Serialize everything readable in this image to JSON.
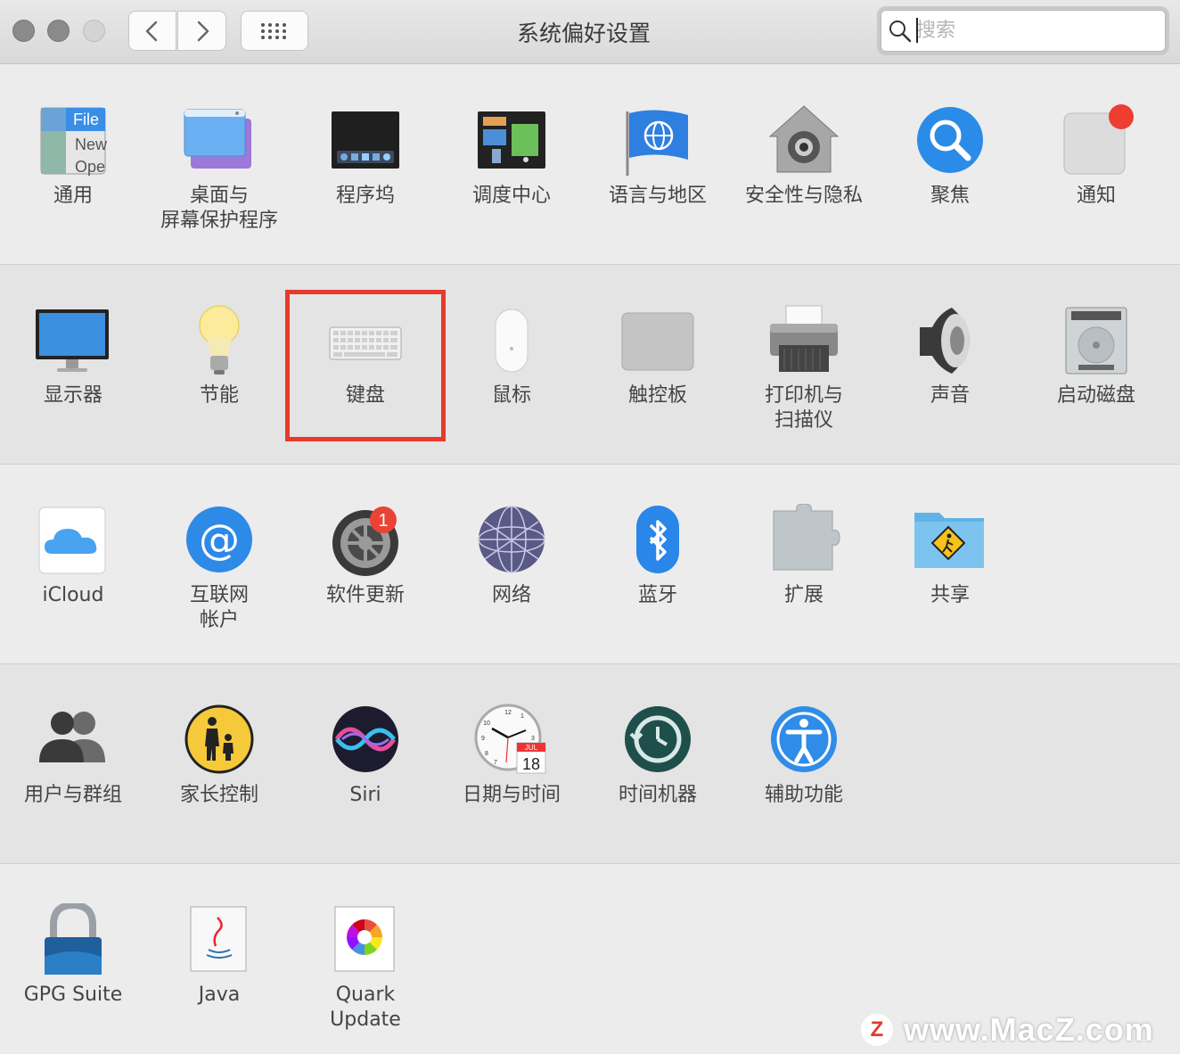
{
  "window": {
    "title": "系统偏好设置"
  },
  "search": {
    "placeholder": "搜索"
  },
  "toolbar": {
    "back_icon": "chevron-left-icon",
    "forward_icon": "chevron-right-icon",
    "grid_icon": "grid-icon"
  },
  "rows": [
    [
      {
        "id": "general",
        "label": [
          "通用"
        ]
      },
      {
        "id": "desktop",
        "label": [
          "桌面与",
          "屏幕保护程序"
        ]
      },
      {
        "id": "dock",
        "label": [
          "程序坞"
        ]
      },
      {
        "id": "mission",
        "label": [
          "调度中心"
        ]
      },
      {
        "id": "language",
        "label": [
          "语言与地区"
        ]
      },
      {
        "id": "security",
        "label": [
          "安全性与隐私"
        ]
      },
      {
        "id": "spotlight",
        "label": [
          "聚焦"
        ]
      },
      {
        "id": "notifications",
        "label": [
          "通知"
        ]
      }
    ],
    [
      {
        "id": "displays",
        "label": [
          "显示器"
        ]
      },
      {
        "id": "energy",
        "label": [
          "节能"
        ]
      },
      {
        "id": "keyboard",
        "label": [
          "键盘"
        ]
      },
      {
        "id": "mouse",
        "label": [
          "鼠标"
        ]
      },
      {
        "id": "trackpad",
        "label": [
          "触控板"
        ]
      },
      {
        "id": "printers",
        "label": [
          "打印机与",
          "扫描仪"
        ]
      },
      {
        "id": "sound",
        "label": [
          "声音"
        ]
      },
      {
        "id": "startup",
        "label": [
          "启动磁盘"
        ]
      }
    ],
    [
      {
        "id": "icloud",
        "label": [
          "iCloud"
        ]
      },
      {
        "id": "internet",
        "label": [
          "互联网",
          "帐户"
        ]
      },
      {
        "id": "update",
        "label": [
          "软件更新"
        ],
        "badge": "1"
      },
      {
        "id": "network",
        "label": [
          "网络"
        ]
      },
      {
        "id": "bluetooth",
        "label": [
          "蓝牙"
        ]
      },
      {
        "id": "extensions",
        "label": [
          "扩展"
        ]
      },
      {
        "id": "sharing",
        "label": [
          "共享"
        ]
      }
    ],
    [
      {
        "id": "users",
        "label": [
          "用户与群组"
        ]
      },
      {
        "id": "parental",
        "label": [
          "家长控制"
        ]
      },
      {
        "id": "siri",
        "label": [
          "Siri"
        ]
      },
      {
        "id": "datetime",
        "label": [
          "日期与时间"
        ],
        "calendar": {
          "month": "JUL",
          "day": "18"
        },
        "clock_numbers": [
          "12",
          "1",
          "3",
          "10",
          "9",
          "8",
          "7"
        ]
      },
      {
        "id": "timemachine",
        "label": [
          "时间机器"
        ]
      },
      {
        "id": "accessibility",
        "label": [
          "辅助功能"
        ]
      }
    ],
    [
      {
        "id": "gpg",
        "label": [
          "GPG Suite"
        ]
      },
      {
        "id": "java",
        "label": [
          "Java"
        ]
      },
      {
        "id": "quark",
        "label": [
          "Quark",
          "Update"
        ]
      }
    ]
  ],
  "general_icon_text": [
    "File",
    "New",
    "Ope"
  ],
  "highlighted": "keyboard",
  "watermark": {
    "logo_letter": "Z",
    "text": "www.MacZ.com"
  }
}
